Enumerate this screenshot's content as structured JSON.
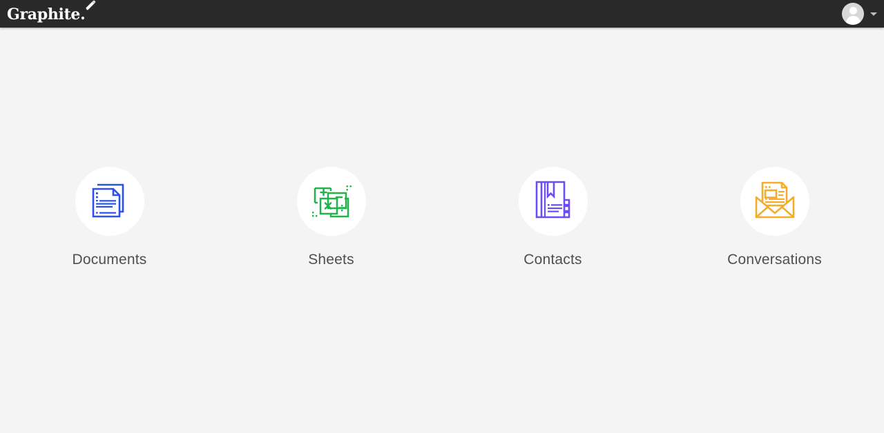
{
  "header": {
    "brand_name": "Graphite.",
    "brand_icon": "pencil-icon",
    "avatar_icon": "user-avatar-icon",
    "caret_icon": "chevron-down-icon",
    "background_color": "#292929",
    "brand_color": "#ffffff"
  },
  "page": {
    "background_color": "#f4f4f4",
    "label_color": "#4f4f4f"
  },
  "apps": [
    {
      "label": "Documents",
      "icon": "documents-icon",
      "color": "#2a50f0"
    },
    {
      "label": "Sheets",
      "icon": "sheets-icon",
      "color": "#22b24c"
    },
    {
      "label": "Contacts",
      "icon": "contacts-icon",
      "color": "#6b4cf6"
    },
    {
      "label": "Conversations",
      "icon": "conversations-icon",
      "color": "#f5ac28"
    }
  ]
}
